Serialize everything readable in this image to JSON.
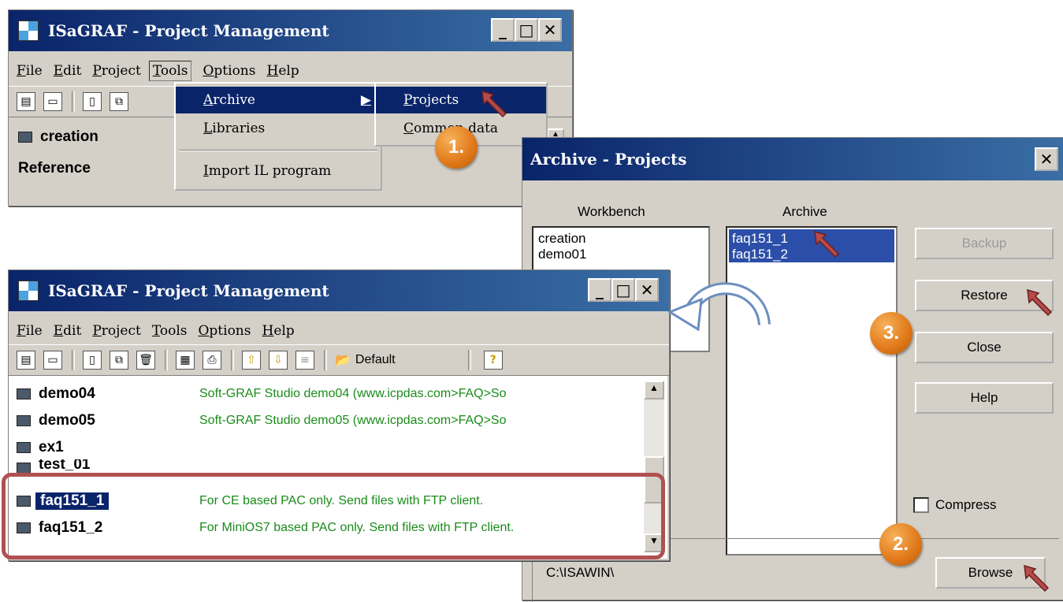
{
  "top_window": {
    "title": "ISaGRAF - Project Management",
    "menu": [
      "File",
      "Edit",
      "Project",
      "Tools",
      "Options",
      "Help"
    ],
    "project": "creation",
    "reference_label": "Reference"
  },
  "tools_menu": {
    "items": [
      "Archive",
      "Libraries",
      "Import IL program"
    ]
  },
  "archive_submenu": {
    "items": [
      "Projects",
      "Common data"
    ]
  },
  "archive_dialog": {
    "title": "Archive - Projects",
    "workbench_label": "Workbench",
    "archive_label": "Archive",
    "workbench_items": [
      "creation",
      "demo01"
    ],
    "archive_items": [
      "faq151_1",
      "faq151_2"
    ],
    "buttons": {
      "backup": "Backup",
      "restore": "Restore",
      "close": "Close",
      "help": "Help",
      "browse": "Browse"
    },
    "compress_label": "Compress",
    "path": "C:\\ISAWIN\\"
  },
  "bottom_window": {
    "title": "ISaGRAF - Project Management",
    "menu": [
      "File",
      "Edit",
      "Project",
      "Tools",
      "Options",
      "Help"
    ],
    "toolbar_default": "Default",
    "projects": [
      {
        "name": "demo04",
        "desc": "Soft-GRAF Studio demo04  (www.icpdas.com>FAQ>So"
      },
      {
        "name": "demo05",
        "desc": "Soft-GRAF Studio demo05  (www.icpdas.com>FAQ>So"
      },
      {
        "name": "ex1",
        "desc": ""
      },
      {
        "name": "test_01",
        "desc": ""
      },
      {
        "name": "faq151_1",
        "desc": "For CE based PAC only. Send files with FTP client."
      },
      {
        "name": "faq151_2",
        "desc": "For MiniOS7 based PAC only. Send files with FTP client."
      }
    ]
  },
  "callouts": [
    "1.",
    "2.",
    "3."
  ],
  "colors": {
    "title_bar": "#0a246a",
    "highlight_box": "#b05050",
    "callout": "#e07818",
    "desc_text": "#1a8c1a"
  }
}
